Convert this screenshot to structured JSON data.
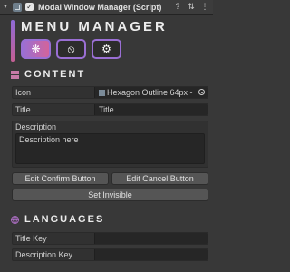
{
  "inspector": {
    "component_title": "Modal Window Manager (Script)",
    "icons": [
      "fold-arrow-icon",
      "script-icon",
      "checkbox-icon",
      "help-icon",
      "preset-icon",
      "more-icon"
    ]
  },
  "header": {
    "title": "MENU MANAGER",
    "tabs": [
      {
        "name": "tab-content",
        "icon": "grid-icon",
        "glyph": "❋",
        "active": true
      },
      {
        "name": "tab-resources",
        "icon": "compass-icon",
        "glyph": "⦸",
        "active": false
      },
      {
        "name": "tab-settings",
        "icon": "gear-icon",
        "glyph": "⚙",
        "active": false
      }
    ]
  },
  "content": {
    "section_title": "CONTENT",
    "icon_label": "Icon",
    "icon_value": "Hexagon Outline 64px -",
    "title_label": "Title",
    "title_value": "Title",
    "description_label": "Description",
    "description_value": "Description here",
    "edit_confirm_label": "Edit Confirm Button",
    "edit_cancel_label": "Edit Cancel Button",
    "set_invisible_label": "Set Invisible"
  },
  "languages": {
    "section_title": "LANGUAGES",
    "title_key_label": "Title Key",
    "title_key_value": "",
    "description_key_label": "Description Key",
    "description_key_value": ""
  },
  "colors": {
    "accent_start": "#9a6fd4",
    "accent_end": "#d2649b",
    "section_icon_content": "#c77aa6",
    "section_icon_languages": "#b070c8"
  }
}
